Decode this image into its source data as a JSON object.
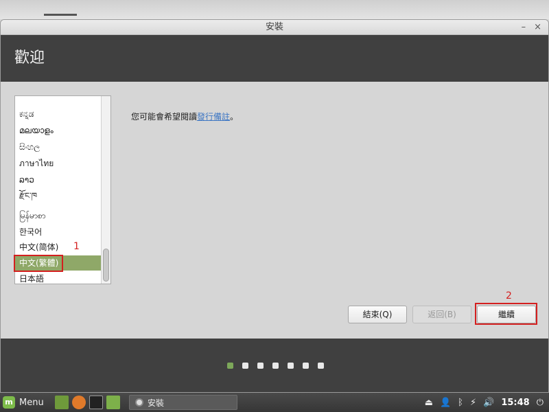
{
  "window": {
    "title": "安裝",
    "minimize": "–",
    "close": "×"
  },
  "header": {
    "title": "歡迎"
  },
  "languages": [
    "ಕನ್ನಡ",
    "മലയാളം",
    "සිංහල",
    "ภาษาไทย",
    "ລາວ",
    "རྫོང་ཁ",
    "မြန်မာစာ",
    "한국어",
    "中文(简体)",
    "中文(繁體)",
    "日本語"
  ],
  "selected_language": "中文(繁體)",
  "notes": {
    "prefix": "您可能會希望閱讀",
    "link": "發行備註",
    "suffix": "。"
  },
  "buttons": {
    "quit": "結束(Q)",
    "back": "返回(B)",
    "continue": "繼續"
  },
  "annotations": {
    "marker1": "1",
    "marker2": "2"
  },
  "progress": {
    "total_steps": 7,
    "current_step": 1
  },
  "taskbar": {
    "menu": "Menu",
    "task_title": "安裝",
    "clock": "15:48"
  },
  "colors": {
    "accent": "#8fa868",
    "header_bg": "#404040",
    "annotation": "#d41f1f",
    "link": "#3d76c3"
  }
}
